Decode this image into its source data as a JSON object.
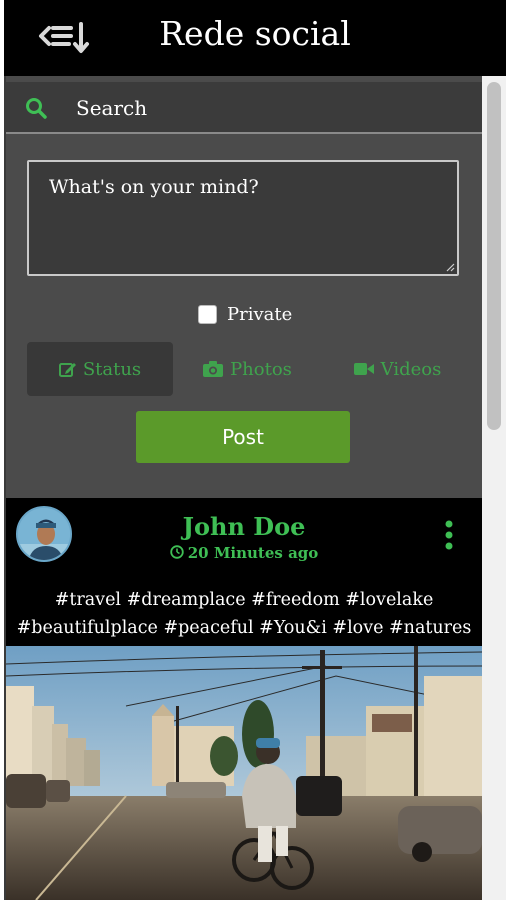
{
  "header": {
    "title": "Rede social",
    "menu_icon": "menu-collapse-icon"
  },
  "search": {
    "placeholder": "Search",
    "icon": "search-icon"
  },
  "composer": {
    "placeholder": "What's on your mind?",
    "private_label": "Private",
    "private_checked": false,
    "tabs": [
      {
        "label": "Status",
        "icon": "edit-icon",
        "active": true
      },
      {
        "label": "Photos",
        "icon": "camera-icon",
        "active": false
      },
      {
        "label": "Videos",
        "icon": "video-icon",
        "active": false
      }
    ],
    "post_label": "Post"
  },
  "feed": {
    "post": {
      "author": "John Doe",
      "time": "20 Minutes ago",
      "hashtags_line1": "#travel #dreamplace #freedom #lovelake",
      "hashtags_line2": "#beautifulplace #peaceful #You&i #love #natures"
    }
  },
  "colors": {
    "accent_green": "#3fbf55",
    "button_green": "#5b9a2a",
    "header_bg": "#000000",
    "panel_bg": "#4b4b4b"
  }
}
